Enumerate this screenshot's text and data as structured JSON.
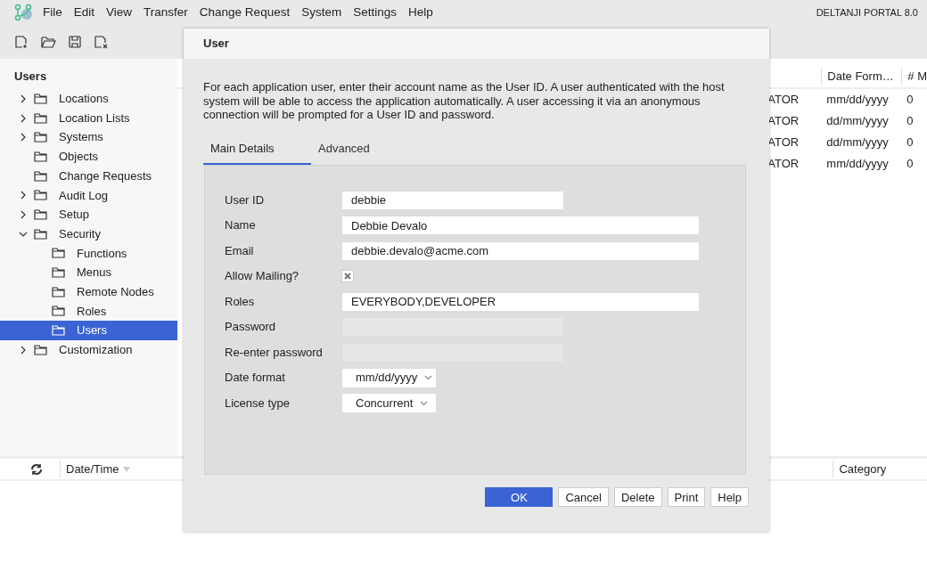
{
  "menu_bar": {
    "items": [
      "File",
      "Edit",
      "View",
      "Transfer",
      "Change Request",
      "System",
      "Settings",
      "Help"
    ],
    "product": "DELTANJI PORTAL 8.0"
  },
  "sidebar": {
    "title": "Users",
    "items": [
      {
        "label": "Locations",
        "expanded": false,
        "selected": false
      },
      {
        "label": "Location Lists",
        "expanded": false,
        "selected": false
      },
      {
        "label": "Systems",
        "expanded": false,
        "selected": false
      },
      {
        "label": "Objects",
        "selected": false
      },
      {
        "label": "Change Requests",
        "selected": false
      },
      {
        "label": "Audit Log",
        "expanded": false,
        "selected": false
      },
      {
        "label": "Setup",
        "expanded": false,
        "selected": false
      },
      {
        "label": "Security",
        "expanded": true,
        "selected": false,
        "children": [
          {
            "label": "Functions",
            "selected": false
          },
          {
            "label": "Menus",
            "selected": false
          },
          {
            "label": "Remote Nodes",
            "selected": false
          },
          {
            "label": "Roles",
            "selected": false
          },
          {
            "label": "Users",
            "selected": true
          }
        ]
      },
      {
        "label": "Customization",
        "expanded": false,
        "selected": false
      }
    ]
  },
  "table": {
    "columns": [
      "",
      "Date Form…",
      "# M"
    ],
    "rows": [
      [
        "ATOR",
        "mm/dd/yyyy",
        "0"
      ],
      [
        "ATOR",
        "dd/mm/yyyy",
        "0"
      ],
      [
        "ATOR",
        "dd/mm/yyyy",
        "0"
      ],
      [
        "ATOR",
        "mm/dd/yyyy",
        "0"
      ]
    ]
  },
  "log_panel": {
    "columns": [
      "Date/Time",
      "Category"
    ]
  },
  "dialog": {
    "title": "User",
    "description": "For each application user, enter their account name as the User ID. A user authenticated with the host system will be able to access the application automatically. A user accessing it via an anonymous connection will be prompted for a User ID and password.",
    "tabs": [
      {
        "label": "Main Details",
        "selected": true
      },
      {
        "label": "Advanced",
        "selected": false
      }
    ],
    "fields": [
      {
        "kind": "text",
        "label": "User ID",
        "value": "debbie",
        "disabled": false
      },
      {
        "kind": "text",
        "label": "Name",
        "value": "Debbie Devalo",
        "disabled": false
      },
      {
        "kind": "text",
        "label": "Email",
        "value": "debbie.devalo@acme.com",
        "disabled": false
      },
      {
        "kind": "checkbox",
        "label": "Allow Mailing?",
        "checked": true
      },
      {
        "kind": "text",
        "label": "Roles",
        "value": "EVERYBODY,DEVELOPER",
        "disabled": false
      },
      {
        "kind": "text",
        "label": "Password",
        "disabled": true
      },
      {
        "kind": "text",
        "label": "Re-enter password",
        "disabled": true
      },
      {
        "kind": "select",
        "label": "Date format",
        "value": "mm/dd/yyyy"
      },
      {
        "kind": "select",
        "label": "License type",
        "value": "Concurrent"
      }
    ],
    "buttons": [
      {
        "label": "OK",
        "kind": "primary"
      },
      {
        "label": "Cancel",
        "kind": "default"
      },
      {
        "label": "Delete",
        "kind": "default"
      },
      {
        "label": "Print",
        "kind": "default"
      },
      {
        "label": "Help",
        "kind": "default"
      }
    ]
  }
}
